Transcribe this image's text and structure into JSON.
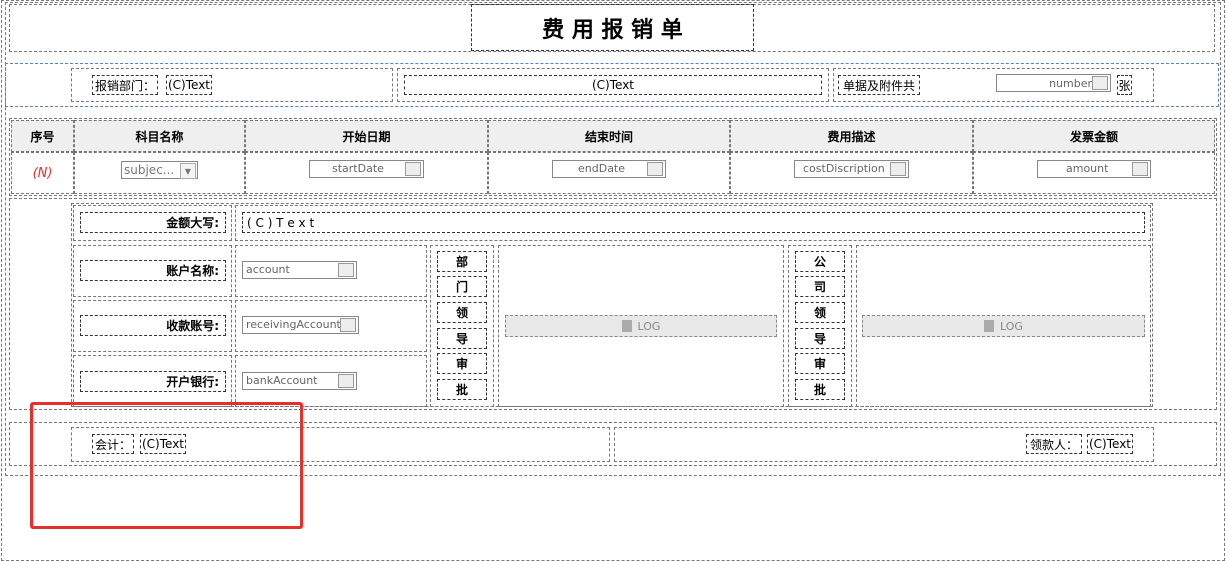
{
  "form": {
    "title": "费 用 报 销 单",
    "dept_label": "报销部门：",
    "dept_value": "(C)Text",
    "center_value": "(C)Text",
    "attach_label": "单据及附件共",
    "attach_field": "number",
    "attach_unit": "张"
  },
  "table": {
    "headers": [
      "序号",
      "科目名称",
      "开始日期",
      "结束时间",
      "费用描述",
      "发票金额"
    ],
    "row": {
      "index": "(N)",
      "subject": "subjec...",
      "start": "startDate",
      "end": "endDate",
      "desc": "costDiscription",
      "amount": "amount"
    }
  },
  "details": {
    "amount_upper_label": "金额大写:",
    "amount_upper_value": "( C ) T e x t",
    "account_name_label": "账户名称:",
    "account_name_value": "account",
    "receiving_label": "收款账号:",
    "receiving_value": "receivingAccount",
    "bank_label": "开户银行:",
    "bank_value": "bankAccount",
    "dept_approve": [
      "部",
      "门",
      "领",
      "导",
      "审",
      "批"
    ],
    "company_approve": [
      "公",
      "司",
      "领",
      "导",
      "审",
      "批"
    ],
    "log1": "LOG",
    "log2": "LOG"
  },
  "footer": {
    "accountant_label": "会计：",
    "accountant_value": "(C)Text",
    "receiver_label": "领款人：",
    "receiver_value": "(C)Text"
  },
  "annotation_color": "#e53030"
}
